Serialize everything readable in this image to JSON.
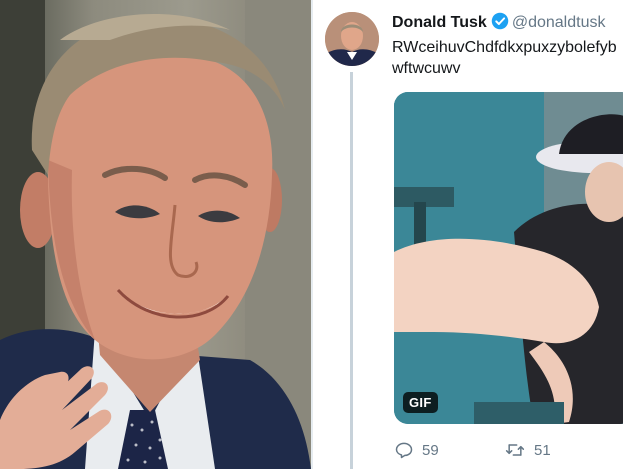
{
  "tweet": {
    "display_name": "Donald Tusk",
    "handle": "@donaldtusk",
    "text": "RWceihuvChdfdkxpuxzybolefybwftwcuwv",
    "media_badge": "GIF",
    "reply_count": "59",
    "retweet_count": "51"
  },
  "colors": {
    "verified_badge": "#1da1f2",
    "secondary_text": "#657786",
    "primary_text": "#14171a"
  },
  "icons": {
    "verified": "verified-badge-icon",
    "reply": "reply-icon",
    "retweet": "retweet-icon"
  }
}
